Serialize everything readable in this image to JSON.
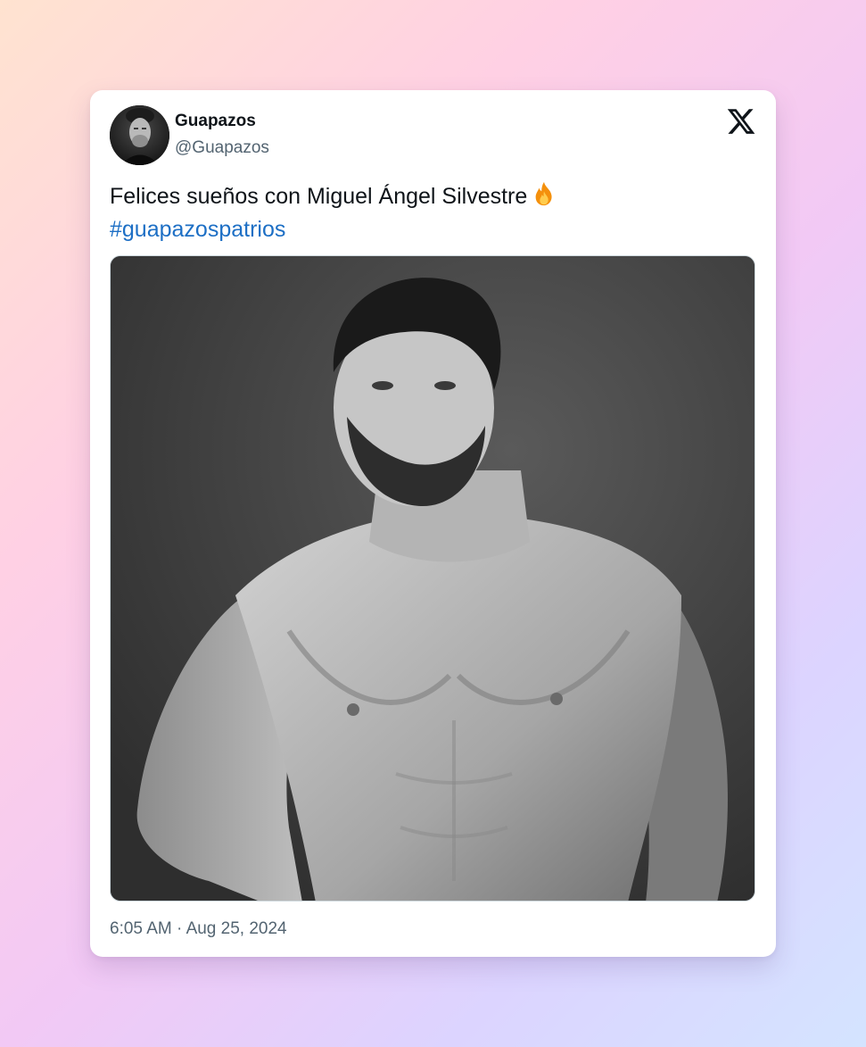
{
  "user": {
    "display_name": "Guapazos",
    "handle": "@Guapazos"
  },
  "tweet": {
    "text": "Felices sueños con Miguel Ángel Silvestre",
    "emoji_icon": "fire-icon",
    "hashtag": "#guapazospatrios",
    "time": "6:05 AM",
    "separator": " · ",
    "date": "Aug 25, 2024"
  },
  "brand": {
    "logo_icon": "x-logo-icon"
  },
  "colors": {
    "hashtag": "#1d6fc5",
    "text": "#0f1419",
    "muted": "#536471"
  }
}
